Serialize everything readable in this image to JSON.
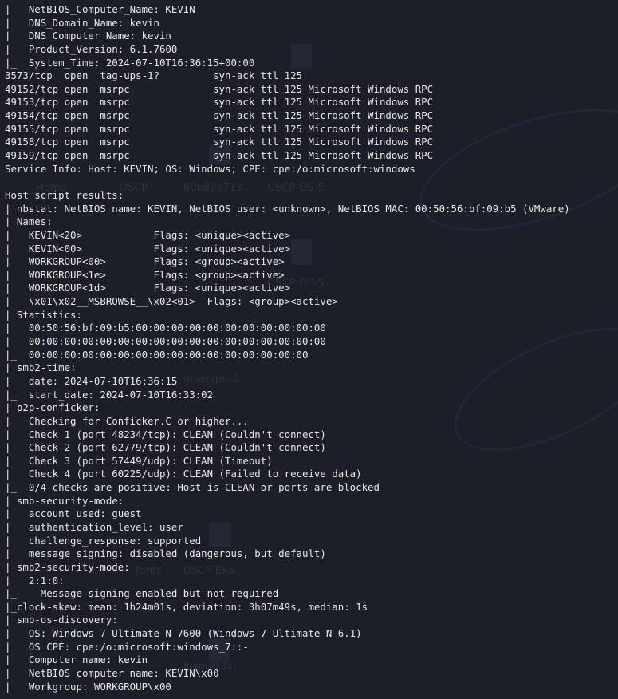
{
  "background_labels": [
    "Home",
    "OSCP",
    "60b88e713...",
    "OSCP-OS-5...",
    "openvpn-2...",
    "OSCP-Exa...",
    "lhsport.txt",
    "fonts",
    "OSCP-OS-5..."
  ],
  "terminal": {
    "lines": [
      "|   NetBIOS_Computer_Name: KEVIN",
      "|   DNS_Domain_Name: kevin",
      "|   DNS_Computer_Name: kevin",
      "|   Product_Version: 6.1.7600",
      "|_  System_Time: 2024-07-10T16:36:15+00:00",
      "3573/tcp  open  tag-ups-1?         syn-ack ttl 125",
      "49152/tcp open  msrpc              syn-ack ttl 125 Microsoft Windows RPC",
      "49153/tcp open  msrpc              syn-ack ttl 125 Microsoft Windows RPC",
      "49154/tcp open  msrpc              syn-ack ttl 125 Microsoft Windows RPC",
      "49155/tcp open  msrpc              syn-ack ttl 125 Microsoft Windows RPC",
      "49158/tcp open  msrpc              syn-ack ttl 125 Microsoft Windows RPC",
      "49159/tcp open  msrpc              syn-ack ttl 125 Microsoft Windows RPC",
      "Service Info: Host: KEVIN; OS: Windows; CPE: cpe:/o:microsoft:windows",
      "",
      "Host script results:",
      "| nbstat: NetBIOS name: KEVIN, NetBIOS user: <unknown>, NetBIOS MAC: 00:50:56:bf:09:b5 (VMware)",
      "| Names:",
      "|   KEVIN<20>            Flags: <unique><active>",
      "|   KEVIN<00>            Flags: <unique><active>",
      "|   WORKGROUP<00>        Flags: <group><active>",
      "|   WORKGROUP<1e>        Flags: <group><active>",
      "|   WORKGROUP<1d>        Flags: <unique><active>",
      "|   \\x01\\x02__MSBROWSE__\\x02<01>  Flags: <group><active>",
      "| Statistics:",
      "|   00:50:56:bf:09:b5:00:00:00:00:00:00:00:00:00:00:00",
      "|   00:00:00:00:00:00:00:00:00:00:00:00:00:00:00:00:00",
      "|_  00:00:00:00:00:00:00:00:00:00:00:00:00:00:00:00",
      "| smb2-time:",
      "|   date: 2024-07-10T16:36:15",
      "|_  start_date: 2024-07-10T16:33:02",
      "| p2p-conficker:",
      "|   Checking for Conficker.C or higher...",
      "|   Check 1 (port 48234/tcp): CLEAN (Couldn't connect)",
      "|   Check 2 (port 62779/tcp): CLEAN (Couldn't connect)",
      "|   Check 3 (port 57449/udp): CLEAN (Timeout)",
      "|   Check 4 (port 60225/udp): CLEAN (Failed to receive data)",
      "|_  0/4 checks are positive: Host is CLEAN or ports are blocked",
      "| smb-security-mode:",
      "|   account_used: guest",
      "|   authentication_level: user",
      "|   challenge_response: supported",
      "|_  message_signing: disabled (dangerous, but default)",
      "| smb2-security-mode:",
      "|   2:1:0:",
      "|_    Message signing enabled but not required",
      "|_clock-skew: mean: 1h24m01s, deviation: 3h07m49s, median: 1s",
      "| smb-os-discovery:",
      "|   OS: Windows 7 Ultimate N 7600 (Windows 7 Ultimate N 6.1)",
      "|   OS CPE: cpe:/o:microsoft:windows_7::-",
      "|   Computer name: kevin",
      "|   NetBIOS computer name: KEVIN\\x00",
      "|   Workgroup: WORKGROUP\\x00"
    ]
  }
}
